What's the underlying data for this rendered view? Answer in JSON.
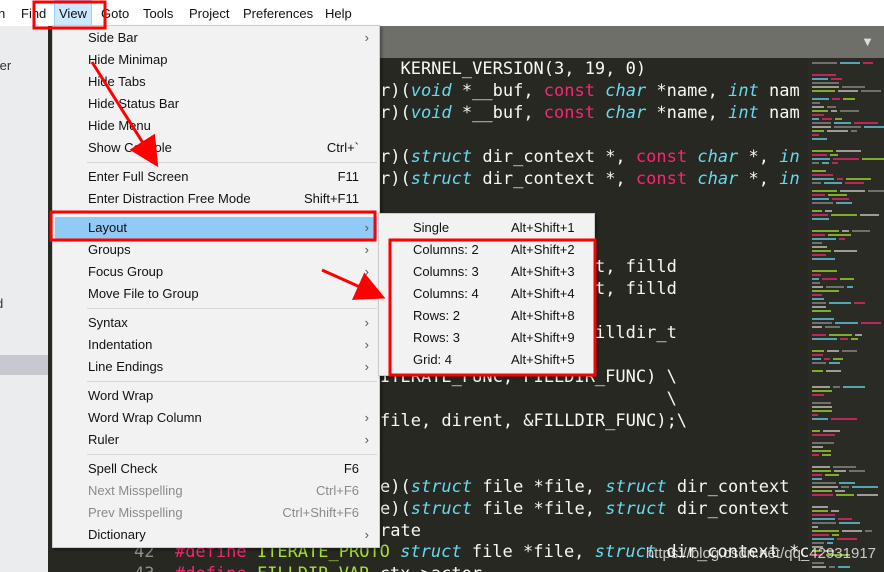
{
  "menubar": {
    "items": [
      "n",
      "Find",
      "View",
      "Goto",
      "Tools",
      "Project",
      "Preferences",
      "Help"
    ],
    "active": "View"
  },
  "sidebar": {
    "fragments": [
      "ter",
      "t",
      "d"
    ]
  },
  "tabbar": {
    "dropdown_icon": "triangle-down"
  },
  "code_lines": [
    [
      {
        "t": "  KERNEL_VERSION(3, 19, 0)"
      }
    ],
    [
      {
        "t": "r)("
      },
      {
        "t": "void",
        "c": "ty"
      },
      {
        "t": " *__buf, "
      },
      {
        "t": "const",
        "c": "kw"
      },
      {
        "t": " "
      },
      {
        "t": "char",
        "c": "ty"
      },
      {
        "t": " *name, "
      },
      {
        "t": "int",
        "c": "ty"
      },
      {
        "t": " nam"
      }
    ],
    [
      {
        "t": "r)("
      },
      {
        "t": "void",
        "c": "ty"
      },
      {
        "t": " *__buf, "
      },
      {
        "t": "const",
        "c": "kw"
      },
      {
        "t": " "
      },
      {
        "t": "char",
        "c": "ty"
      },
      {
        "t": " *name, "
      },
      {
        "t": "int",
        "c": "ty"
      },
      {
        "t": " nam"
      }
    ],
    [],
    [
      {
        "t": "r)("
      },
      {
        "t": "struct",
        "c": "ty"
      },
      {
        "t": " dir_context *, "
      },
      {
        "t": "const",
        "c": "kw"
      },
      {
        "t": " "
      },
      {
        "t": "char",
        "c": "ty"
      },
      {
        "t": " *, "
      },
      {
        "t": "in",
        "c": "ty"
      }
    ],
    [
      {
        "t": "r)("
      },
      {
        "t": "struct",
        "c": "ty"
      },
      {
        "t": " dir_context *, "
      },
      {
        "t": "const",
        "c": "kw"
      },
      {
        "t": " "
      },
      {
        "t": "char",
        "c": "ty"
      },
      {
        "t": " *, "
      },
      {
        "t": "in",
        "c": "ty"
      }
    ],
    [],
    [],
    [
      {
        "t": "           1, 0)"
      }
    ],
    [
      {
        "t": "        , "
      },
      {
        "t": "void",
        "c": "ty"
      },
      {
        "t": " *dirent, filld"
      }
    ],
    [
      {
        "t": "        , "
      },
      {
        "t": "void",
        "c": "ty"
      },
      {
        "t": " *dirent, filld"
      }
    ],
    [],
    [
      {
        "t": "         "
      },
      {
        "t": "d",
        "c": "ty"
      },
      {
        "t": " *dirent, filldir_t"
      }
    ],
    [],
    [
      {
        "t": "ITERATE_FUNC, FILLDIR_FUNC) \\"
      }
    ],
    [
      {
        "t": "                            \\"
      }
    ],
    [
      {
        "t": "file, dirent, &FILLDIR_FUNC);\\"
      }
    ],
    [],
    [],
    [
      {
        "t": "e)("
      },
      {
        "t": "struct",
        "c": "ty"
      },
      {
        "t": " file *file, "
      },
      {
        "t": "struct",
        "c": "ty"
      },
      {
        "t": " dir_context"
      }
    ],
    [
      {
        "t": "e)("
      },
      {
        "t": "struct",
        "c": "ty"
      },
      {
        "t": " file *file, "
      },
      {
        "t": "struct",
        "c": "ty"
      },
      {
        "t": " dir_context"
      }
    ],
    [
      {
        "t": "rate"
      }
    ]
  ],
  "code_bottom": [
    [
      {
        "t": "42  ",
        "c": "ln"
      },
      {
        "t": "#define",
        "c": "kw"
      },
      {
        "t": " "
      },
      {
        "t": "ITERATE_PROTO",
        "c": "mc"
      },
      {
        "t": " "
      },
      {
        "t": "struct",
        "c": "ty"
      },
      {
        "t": " file *file, "
      },
      {
        "t": "struct",
        "c": "ty"
      },
      {
        "t": " dir_context *ctx"
      }
    ],
    [
      {
        "t": "43  ",
        "c": "ln"
      },
      {
        "t": "#define",
        "c": "kw"
      },
      {
        "t": " "
      },
      {
        "t": "FILLDIR_VAR",
        "c": "mc"
      },
      {
        "t": " ctx->actor"
      }
    ]
  ],
  "watermark": "https://blog.csdn.net/qq_42931917",
  "view_menu": {
    "groups": [
      [
        {
          "label": "Side Bar",
          "submenu": true
        },
        {
          "label": "Hide Minimap"
        },
        {
          "label": "Hide Tabs"
        },
        {
          "label": "Hide Status Bar"
        },
        {
          "label": "Hide Menu"
        },
        {
          "label": "Show Console",
          "shortcut": "Ctrl+`"
        }
      ],
      [
        {
          "label": "Enter Full Screen",
          "shortcut": "F11"
        },
        {
          "label": "Enter Distraction Free Mode",
          "shortcut": "Shift+F11"
        }
      ],
      [
        {
          "label": "Layout",
          "submenu": true,
          "highlighted": true
        },
        {
          "label": "Groups",
          "submenu": true
        },
        {
          "label": "Focus Group",
          "submenu": true
        },
        {
          "label": "Move File to Group",
          "submenu": true
        }
      ],
      [
        {
          "label": "Syntax",
          "submenu": true
        },
        {
          "label": "Indentation",
          "submenu": true
        },
        {
          "label": "Line Endings",
          "submenu": true
        }
      ],
      [
        {
          "label": "Word Wrap"
        },
        {
          "label": "Word Wrap Column",
          "submenu": true
        },
        {
          "label": "Ruler",
          "submenu": true
        }
      ],
      [
        {
          "label": "Spell Check",
          "shortcut": "F6"
        },
        {
          "label": "Next Misspelling",
          "shortcut": "Ctrl+F6",
          "disabled": true
        },
        {
          "label": "Prev Misspelling",
          "shortcut": "Ctrl+Shift+F6",
          "disabled": true
        },
        {
          "label": "Dictionary",
          "submenu": true
        }
      ]
    ]
  },
  "layout_menu": {
    "items": [
      {
        "label": "Single",
        "shortcut": "Alt+Shift+1"
      },
      {
        "label": "Columns: 2",
        "shortcut": "Alt+Shift+2"
      },
      {
        "label": "Columns: 3",
        "shortcut": "Alt+Shift+3"
      },
      {
        "label": "Columns: 4",
        "shortcut": "Alt+Shift+4"
      },
      {
        "label": "Rows: 2",
        "shortcut": "Alt+Shift+8"
      },
      {
        "label": "Rows: 3",
        "shortcut": "Alt+Shift+9"
      },
      {
        "label": "Grid: 4",
        "shortcut": "Alt+Shift+5"
      }
    ]
  },
  "colors": {
    "annotation": "#ff0000",
    "highlight": "#91c9f7",
    "editor_bg": "#272822",
    "keyword": "#f92672",
    "type": "#66d9ef"
  }
}
